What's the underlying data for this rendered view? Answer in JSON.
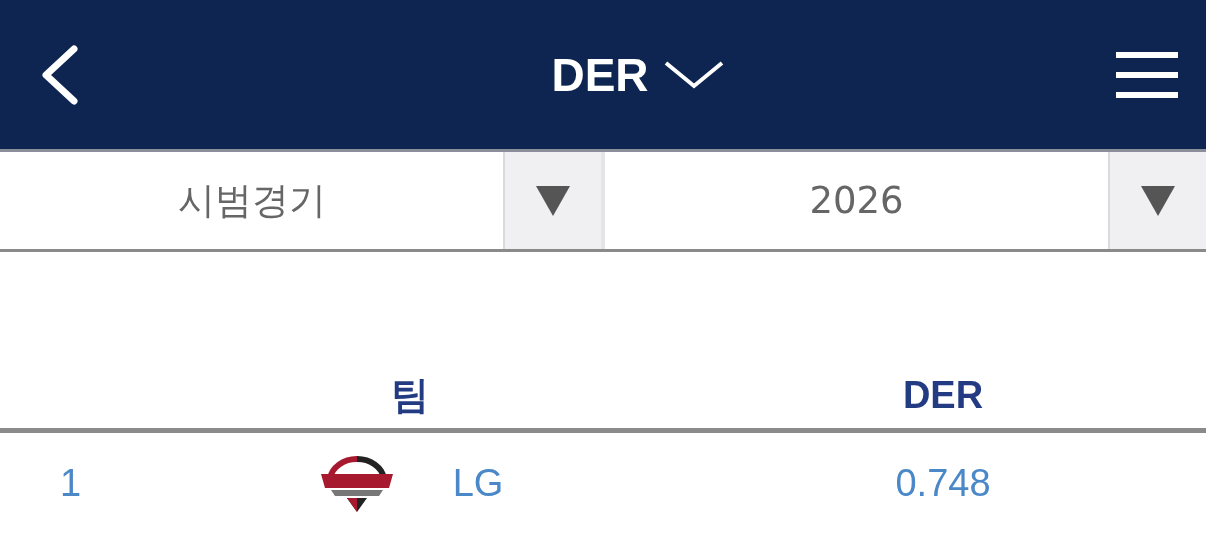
{
  "header": {
    "title": "DER"
  },
  "filters": [
    {
      "value": "시범경기"
    },
    {
      "value": "2026"
    }
  ],
  "table": {
    "columns": [
      "팀",
      "DER"
    ],
    "rows": [
      {
        "rank": "1",
        "team": "LG",
        "value": "0.748"
      }
    ]
  }
}
